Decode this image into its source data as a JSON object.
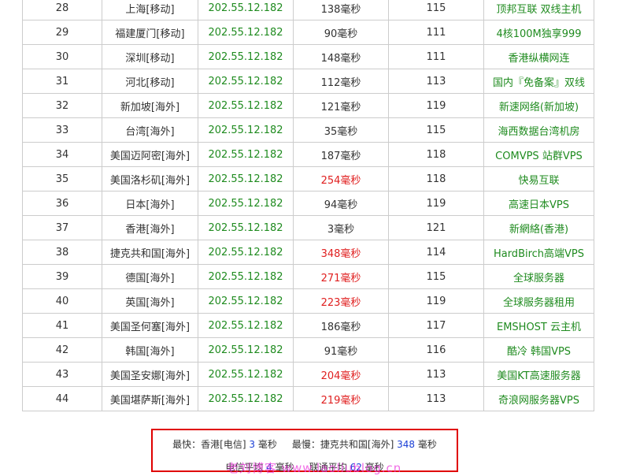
{
  "rows": [
    {
      "no": "28",
      "location": "上海[移动]",
      "ip": "202.55.12.182",
      "latency": "138毫秒",
      "ttl": "115",
      "host": "顶邦互联 双线主机",
      "slow": false
    },
    {
      "no": "29",
      "location": "福建厦门[移动]",
      "ip": "202.55.12.182",
      "latency": "90毫秒",
      "ttl": "111",
      "host": "4核100M独享999",
      "slow": false
    },
    {
      "no": "30",
      "location": "深圳[移动]",
      "ip": "202.55.12.182",
      "latency": "148毫秒",
      "ttl": "111",
      "host": "香港纵横网连",
      "slow": false
    },
    {
      "no": "31",
      "location": "河北[移动]",
      "ip": "202.55.12.182",
      "latency": "112毫秒",
      "ttl": "113",
      "host": "国内『免备案』双线",
      "slow": false
    },
    {
      "no": "32",
      "location": "新加坡[海外]",
      "ip": "202.55.12.182",
      "latency": "121毫秒",
      "ttl": "119",
      "host": "新速网络(新加坡)",
      "slow": false
    },
    {
      "no": "33",
      "location": "台湾[海外]",
      "ip": "202.55.12.182",
      "latency": "35毫秒",
      "ttl": "115",
      "host": "海西数据台湾机房",
      "slow": false
    },
    {
      "no": "34",
      "location": "美国迈阿密[海外]",
      "ip": "202.55.12.182",
      "latency": "187毫秒",
      "ttl": "118",
      "host": "COMVPS 站群VPS",
      "slow": false
    },
    {
      "no": "35",
      "location": "美国洛杉矶[海外]",
      "ip": "202.55.12.182",
      "latency": "254毫秒",
      "ttl": "118",
      "host": "快易互联",
      "slow": true
    },
    {
      "no": "36",
      "location": "日本[海外]",
      "ip": "202.55.12.182",
      "latency": "94毫秒",
      "ttl": "119",
      "host": "高速日本VPS",
      "slow": false
    },
    {
      "no": "37",
      "location": "香港[海外]",
      "ip": "202.55.12.182",
      "latency": "3毫秒",
      "ttl": "121",
      "host": "新網絡(香港)",
      "slow": false
    },
    {
      "no": "38",
      "location": "捷克共和国[海外]",
      "ip": "202.55.12.182",
      "latency": "348毫秒",
      "ttl": "114",
      "host": "HardBirch高端VPS",
      "slow": true
    },
    {
      "no": "39",
      "location": "德国[海外]",
      "ip": "202.55.12.182",
      "latency": "271毫秒",
      "ttl": "115",
      "host": "全球服务器",
      "slow": true
    },
    {
      "no": "40",
      "location": "英国[海外]",
      "ip": "202.55.12.182",
      "latency": "223毫秒",
      "ttl": "119",
      "host": "全球服务器租用",
      "slow": true
    },
    {
      "no": "41",
      "location": "美国圣何塞[海外]",
      "ip": "202.55.12.182",
      "latency": "186毫秒",
      "ttl": "117",
      "host": "EMSHOST 云主机",
      "slow": false
    },
    {
      "no": "42",
      "location": "韩国[海外]",
      "ip": "202.55.12.182",
      "latency": "91毫秒",
      "ttl": "116",
      "host": "酷冷 韩国VPS",
      "slow": false
    },
    {
      "no": "43",
      "location": "美国圣安娜[海外]",
      "ip": "202.55.12.182",
      "latency": "204毫秒",
      "ttl": "113",
      "host": "美国KT高速服务器",
      "slow": true
    },
    {
      "no": "44",
      "location": "美国堪萨斯[海外]",
      "ip": "202.55.12.182",
      "latency": "219毫秒",
      "ttl": "113",
      "host": "奇浪网服务器VPS",
      "slow": true
    }
  ],
  "summary": {
    "fastest_label": "最快：香港[电信]",
    "fastest_value": "3",
    "fastest_unit": "毫秒",
    "slowest_label": "最慢：捷克共和国[海外]",
    "slowest_value": "348",
    "slowest_unit": "毫秒",
    "telecom_label": "电信平均",
    "telecom_value": "4",
    "telecom_unit": "毫秒",
    "unicom_label": "联通平均",
    "unicom_value": "62",
    "unicom_unit": "毫秒"
  },
  "watermark": "老刘博客 www.laoliublog.cn",
  "colors": {
    "ip": "#1f8b1f",
    "host": "#1f8b1f",
    "slow_latency": "#e02020",
    "summary_number": "#1a3fd6",
    "summary_border": "#e00000"
  }
}
